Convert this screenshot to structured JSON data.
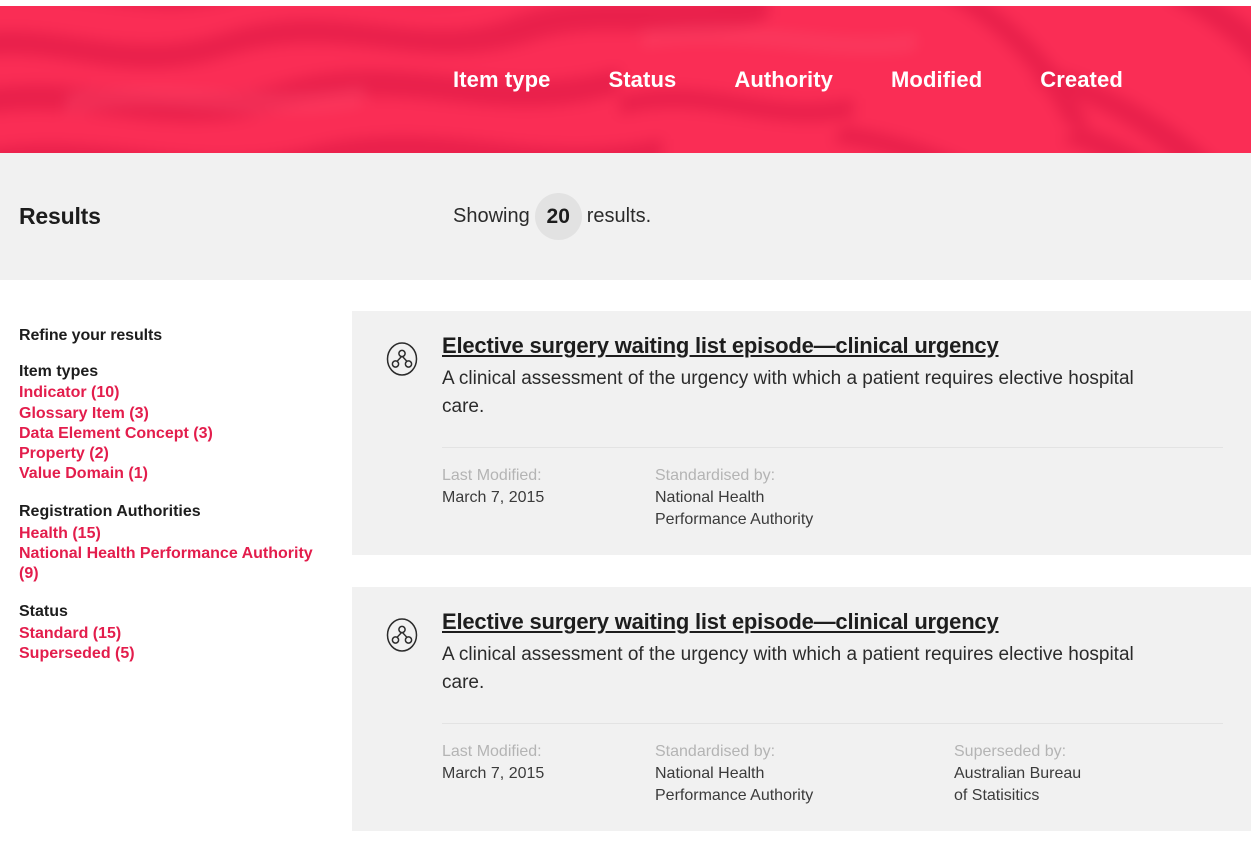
{
  "theme": {
    "brand_pink": "#fa2d55",
    "link_red": "#e31d4c",
    "bar_grey": "#f1f1f1",
    "badge_grey": "#e2e2e2"
  },
  "header": {
    "nav_items": [
      {
        "label": "Item type"
      },
      {
        "label": "Status"
      },
      {
        "label": "Authority"
      },
      {
        "label": "Modified"
      },
      {
        "label": "Created"
      }
    ]
  },
  "results_bar": {
    "title": "Results",
    "showing_prefix": "Showing",
    "count": "20",
    "showing_suffix": "results."
  },
  "sidebar": {
    "heading": "Refine your results",
    "groups": [
      {
        "title": "Item types",
        "facets": [
          {
            "label": "Indicator (10)"
          },
          {
            "label": "Glossary Item (3)"
          },
          {
            "label": "Data Element Concept (3)"
          },
          {
            "label": "Property (2)"
          },
          {
            "label": "Value Domain (1)"
          }
        ]
      },
      {
        "title": "Registration Authorities",
        "facets": [
          {
            "label": "Health (15)"
          },
          {
            "label": "National Health Performance Authority (9)"
          }
        ]
      },
      {
        "title": "Status",
        "facets": [
          {
            "label": "Standard (15)"
          },
          {
            "label": "Superseded (5)"
          }
        ]
      }
    ]
  },
  "results": [
    {
      "icon": "data-element-concept-icon",
      "title": "Elective surgery waiting list episode—clinical urgency",
      "description": "A clinical assessment of the urgency with which a patient requires elective hospital care.",
      "meta": [
        {
          "label": "Last Modified:",
          "value": "March 7, 2015"
        },
        {
          "label": "Standardised by:",
          "value": "National Health\nPerformance Authority"
        }
      ]
    },
    {
      "icon": "data-element-concept-icon",
      "title": "Elective surgery waiting list episode—clinical urgency",
      "description": "A clinical assessment of the urgency with which a patient requires elective hospital care.",
      "meta": [
        {
          "label": "Last Modified:",
          "value": "March 7, 2015"
        },
        {
          "label": "Standardised by:",
          "value": "National Health\nPerformance Authority"
        },
        {
          "label": "Superseded by:",
          "value": "Australian Bureau\nof Statisitics"
        }
      ]
    }
  ]
}
